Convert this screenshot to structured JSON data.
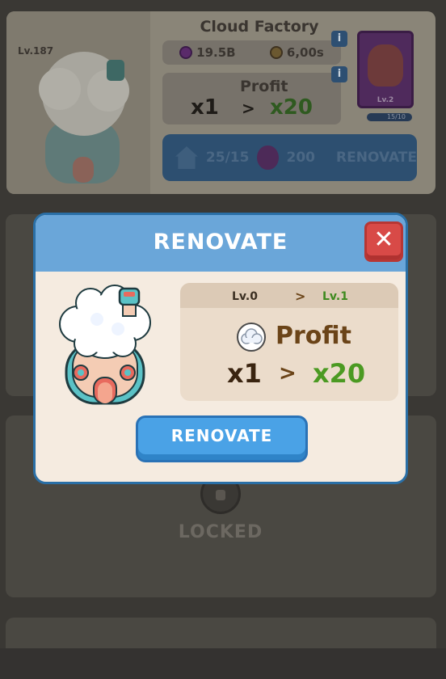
{
  "background": {
    "factory_card": {
      "title": "Cloud Factory",
      "level_badge": "Lv.187",
      "gems": "19.5B",
      "time": "6,00s",
      "info_label": "i",
      "profit_label": "Profit",
      "profit_from": "x1",
      "profit_arrow": ">",
      "profit_to": "x20",
      "manager_level": "Lv.2",
      "manager_progress": "15/10",
      "renovate_houses": "25/15",
      "renovate_potions": "200",
      "renovate_label": "RENOVATE"
    },
    "locked_card": {
      "locked_label": "LOCKED"
    }
  },
  "modal": {
    "title": "RENOVATE",
    "close_label": "✕",
    "level_from": "Lv.0",
    "level_to": "Lv.1",
    "level_arrow": ">",
    "profit_label": "Profit",
    "multiplier_from": "x1",
    "multiplier_arrow": ">",
    "multiplier_to": "x20",
    "renovate_button_label": "RENOVATE"
  },
  "colors": {
    "modal_header": "#6aa6d9",
    "modal_border": "#2a6fa6",
    "modal_body": "#f5ebe0",
    "close_button": "#d84a47",
    "renovate_button": "#4aa2e6",
    "level_to_green": "#3e8a1f",
    "multiplier_green": "#4b9a22",
    "profit_brown": "#6b4418"
  },
  "icons": [
    "cloud-icon",
    "close-icon",
    "tower-icon",
    "lock-icon",
    "gem-icon",
    "timer-icon",
    "house-icon",
    "potion-icon",
    "info-icon"
  ]
}
